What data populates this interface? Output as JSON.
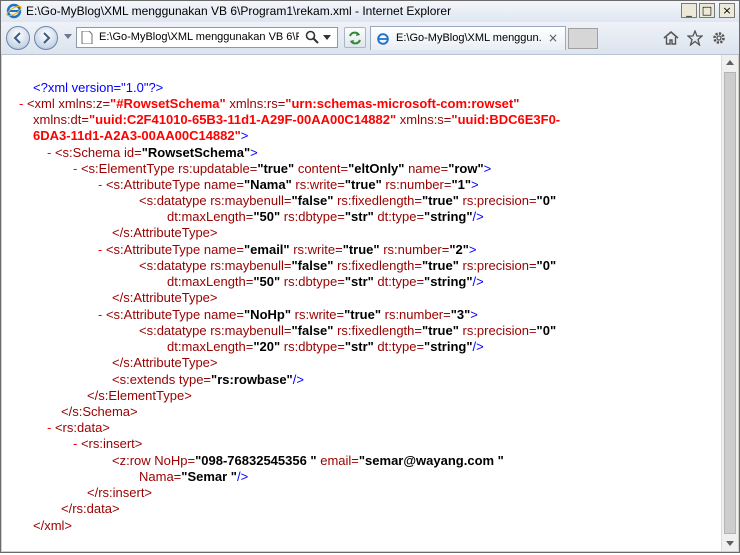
{
  "window": {
    "title": "E:\\Go-MyBlog\\XML menggunakan VB 6\\Program1\\rekam.xml - Internet Explorer",
    "min_label": "_",
    "max_label": "□",
    "close_label": "×"
  },
  "toolbar": {
    "address_url": "E:\\Go-MyBlog\\XML menggunakan VB 6\\Pr",
    "tab_label": "E:\\Go-MyBlog\\XML menggun...",
    "tab_close": "×"
  },
  "xml": {
    "l1": "<?xml version=\"1.0\"?>",
    "l2_minus": "-",
    "l2_open": "<xml",
    "l2_a1": " xmlns:z=",
    "l2_v1": "\"#RowsetSchema\"",
    "l2_a2": " xmlns:rs=",
    "l2_v2": "\"urn:schemas-microsoft-com:rowset\"",
    "l3_a": "xmlns:dt=",
    "l3_v": "\"uuid:C2F41010-65B3-11d1-A29F-00AA00C14882\"",
    "l3_a2": " xmlns:s=",
    "l3_v2": "\"uuid:BDC6E3F0-",
    "l4_v": "6DA3-11d1-A2A3-00AA00C14882\"",
    "l4_close": ">",
    "l5_minus": "-",
    "l5_t": "<s:Schema",
    "l5_a": " id=",
    "l5_v": "\"RowsetSchema\"",
    "l5_c": ">",
    "l6_minus": "-",
    "l6_t": "<s:ElementType",
    "l6_a1": " rs:updatable=",
    "l6_v1": "\"true\"",
    "l6_a2": " content=",
    "l6_v2": "\"eltOnly\"",
    "l6_a3": " name=",
    "l6_v3": "\"row\"",
    "l6_c": ">",
    "attr1": {
      "minus": "-",
      "t": "<s:AttributeType",
      "a1": " name=",
      "v1": "\"Nama\"",
      "a2": " rs:write=",
      "v2": "\"true\"",
      "a3": " rs:number=",
      "v3": "\"1\"",
      "c": ">",
      "d_t": "<s:datatype",
      "d_a1": " rs:maybenull=",
      "d_v1": "\"false\"",
      "d_a2": " rs:fixedlength=",
      "d_v2": "\"true\"",
      "d_a3": " rs:precision=",
      "d_v3": "\"0\"",
      "d2_a1": "dt:maxLength=",
      "d2_v1": "\"50\"",
      "d2_a2": " rs:dbtype=",
      "d2_v2": "\"str\"",
      "d2_a3": " dt:type=",
      "d2_v3": "\"string\"",
      "d2_c": "/>",
      "end": "</s:AttributeType>"
    },
    "attr2": {
      "minus": "-",
      "t": "<s:AttributeType",
      "a1": " name=",
      "v1": "\"email\"",
      "a2": " rs:write=",
      "v2": "\"true\"",
      "a3": " rs:number=",
      "v3": "\"2\"",
      "c": ">",
      "d_t": "<s:datatype",
      "d_a1": " rs:maybenull=",
      "d_v1": "\"false\"",
      "d_a2": " rs:fixedlength=",
      "d_v2": "\"true\"",
      "d_a3": " rs:precision=",
      "d_v3": "\"0\"",
      "d2_a1": "dt:maxLength=",
      "d2_v1": "\"50\"",
      "d2_a2": " rs:dbtype=",
      "d2_v2": "\"str\"",
      "d2_a3": " dt:type=",
      "d2_v3": "\"string\"",
      "d2_c": "/>",
      "end": "</s:AttributeType>"
    },
    "attr3": {
      "minus": "-",
      "t": "<s:AttributeType",
      "a1": " name=",
      "v1": "\"NoHp\"",
      "a2": " rs:write=",
      "v2": "\"true\"",
      "a3": " rs:number=",
      "v3": "\"3\"",
      "c": ">",
      "d_t": "<s:datatype",
      "d_a1": " rs:maybenull=",
      "d_v1": "\"false\"",
      "d_a2": " rs:fixedlength=",
      "d_v2": "\"true\"",
      "d_a3": " rs:precision=",
      "d_v3": "\"0\"",
      "d2_a1": "dt:maxLength=",
      "d2_v1": "\"20\"",
      "d2_a2": " rs:dbtype=",
      "d2_v2": "\"str\"",
      "d2_a3": " dt:type=",
      "d2_v3": "\"string\"",
      "d2_c": "/>",
      "end": "</s:AttributeType>"
    },
    "ext_t": "<s:extends",
    "ext_a": " type=",
    "ext_v": "\"rs:rowbase\"",
    "ext_c": "/>",
    "et_end": "</s:ElementType>",
    "schema_end": "</s:Schema>",
    "data_minus": "-",
    "data_t": "<rs:data>",
    "ins_minus": "-",
    "ins_t": "<rs:insert>",
    "row_t": "<z:row",
    "row_a1": " NoHp=",
    "row_v1": "\"098-76832545356 \"",
    "row_a2": " email=",
    "row_v2": "\"semar@wayang.com \"",
    "row2_a": "Nama=",
    "row2_v": "\"Semar \"",
    "row2_c": "/>",
    "ins_end": "</rs:insert>",
    "data_end": "</rs:data>",
    "xml_end": "</xml>"
  }
}
